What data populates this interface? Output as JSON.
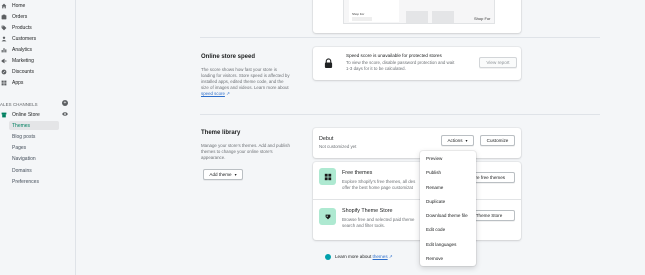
{
  "sidebar": {
    "items": [
      {
        "label": "Home",
        "icon": "home-icon"
      },
      {
        "label": "Orders",
        "icon": "orders-icon"
      },
      {
        "label": "Products",
        "icon": "tag-icon"
      },
      {
        "label": "Customers",
        "icon": "person-icon"
      },
      {
        "label": "Analytics",
        "icon": "bar-chart-icon"
      },
      {
        "label": "Marketing",
        "icon": "megaphone-icon"
      },
      {
        "label": "Discounts",
        "icon": "discount-icon"
      },
      {
        "label": "Apps",
        "icon": "apps-icon"
      }
    ],
    "channels_header": "ALES CHANNELS",
    "online_store": "Online Store",
    "sub_items": [
      "Themes",
      "Blog posts",
      "Pages",
      "Navigation",
      "Domains",
      "Preferences"
    ]
  },
  "preview": {
    "label_left": "Shop For",
    "label_right": "Shop For"
  },
  "speed": {
    "title": "Online store speed",
    "desc_line1": "The score shows how fast your store is",
    "desc_line2": "loading for visitors. Store speed is affected by",
    "desc_line3": "installed apps, edited theme code, and the",
    "desc_line4": "size of images and videos. Learn more about",
    "link": "speed score",
    "card_title": "Speed score is unavailable for protected stores",
    "card_line1": "To view the score, disable password protection and wait",
    "card_line2": "1-3 days for it to be calculated.",
    "view_report": "View report"
  },
  "library": {
    "title": "Theme library",
    "desc_line1": "Manage your store's themes. Add and publish",
    "desc_line2": "themes to change your online store's",
    "desc_line3": "appearance.",
    "add_theme": "Add theme",
    "theme_name": "Debut",
    "theme_status": "Not customized yet",
    "actions": "Actions",
    "customize": "Customize",
    "free_title": "Free themes",
    "free_line1": "Explore Shopify's free themes, all des",
    "free_line2": "offer the best home page customizat",
    "free_btn": "ore free themes",
    "store_title": "Shopify Theme Store",
    "store_line1": "Browse free and selected paid theme",
    "store_line2": "search and filter tools.",
    "store_btn": "Theme Store"
  },
  "actions_menu": [
    "Preview",
    "Publish",
    "Rename",
    "Duplicate",
    "Download theme file",
    "Edit code",
    "Edit languages",
    "Remove"
  ],
  "footer": {
    "text": "Learn more about",
    "link": "themes"
  }
}
